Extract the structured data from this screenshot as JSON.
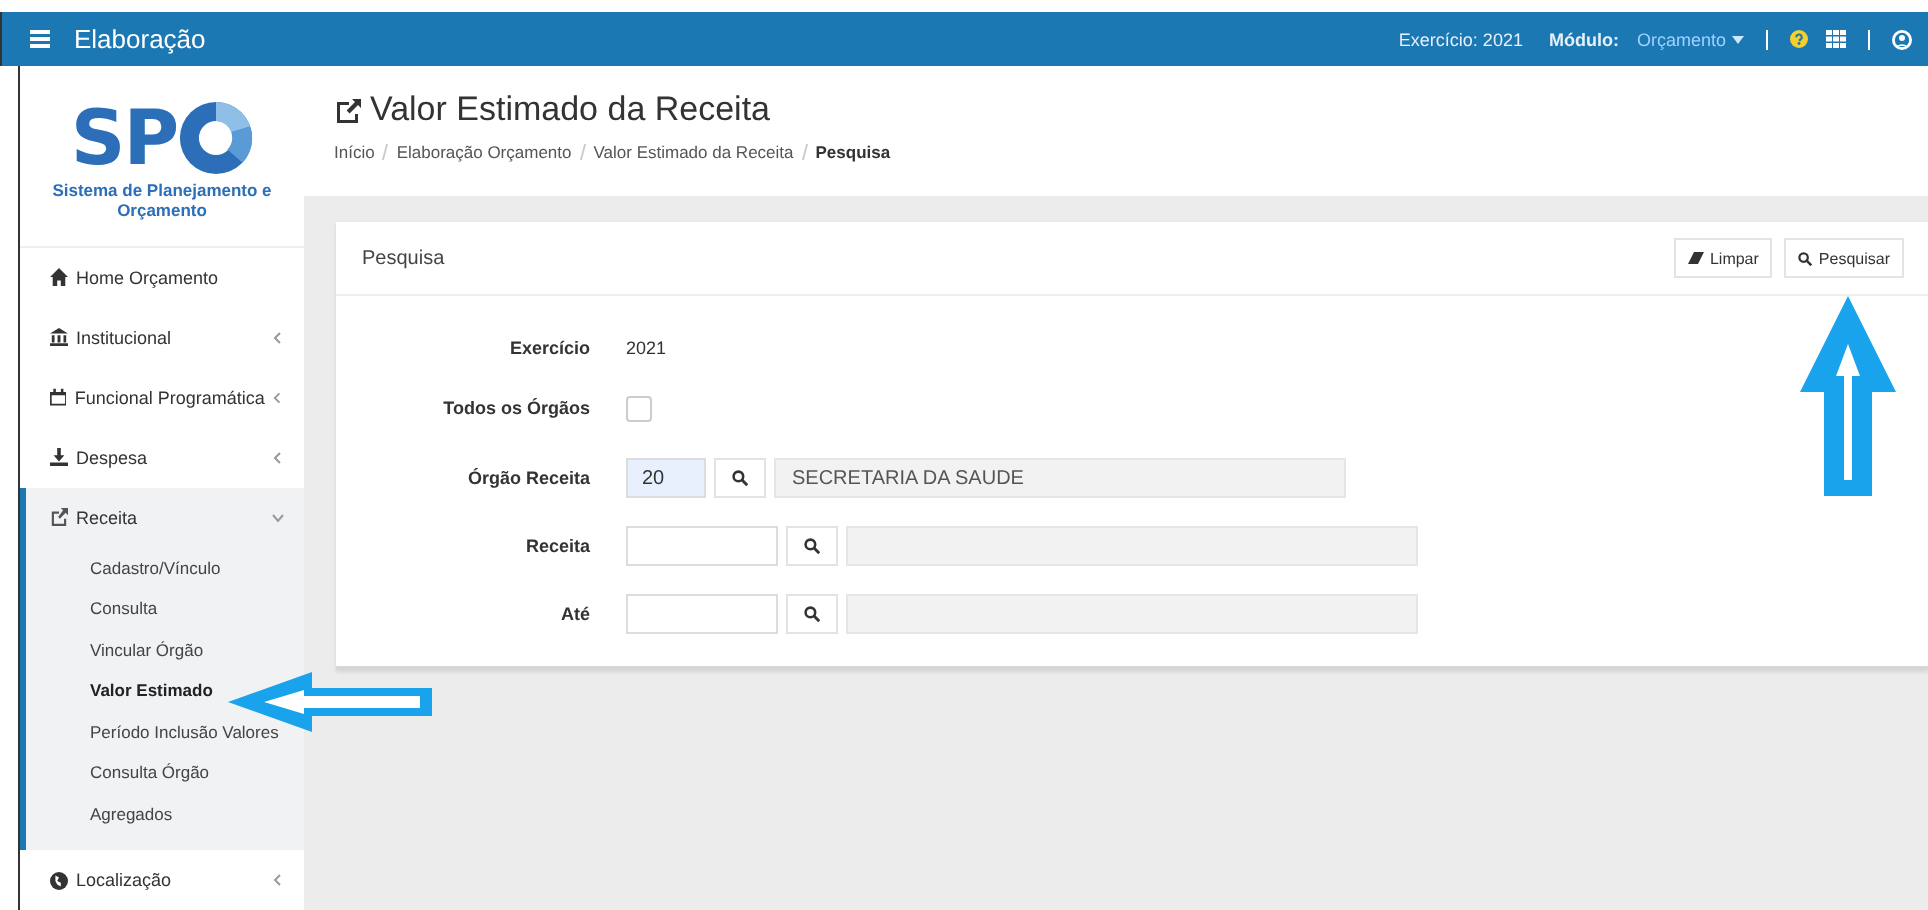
{
  "topbar": {
    "title": "Elaboração",
    "exercise_label": "Exercício:",
    "exercise_value": "2021",
    "module_label": "Módulo:",
    "module_value": "Orçamento"
  },
  "logo": {
    "text": "SP",
    "subtitle": "Sistema de Planejamento e Orçamento"
  },
  "sidebar": {
    "items": [
      {
        "label": "Home Orçamento",
        "has_children": false,
        "expanded": false
      },
      {
        "label": "Institucional",
        "has_children": true,
        "expanded": false
      },
      {
        "label": "Funcional Programática",
        "has_children": true,
        "expanded": false
      },
      {
        "label": "Despesa",
        "has_children": true,
        "expanded": false
      },
      {
        "label": "Receita",
        "has_children": true,
        "expanded": true,
        "children": [
          {
            "label": "Cadastro/Vínculo",
            "selected": false
          },
          {
            "label": "Consulta",
            "selected": false
          },
          {
            "label": "Vincular Órgão",
            "selected": false
          },
          {
            "label": "Valor Estimado",
            "selected": true
          },
          {
            "label": "Período Inclusão Valores",
            "selected": false
          },
          {
            "label": "Consulta Órgão",
            "selected": false
          },
          {
            "label": "Agregados",
            "selected": false
          }
        ]
      },
      {
        "label": "Localização",
        "has_children": true,
        "expanded": false
      }
    ]
  },
  "page": {
    "title": "Valor Estimado da Receita",
    "breadcrumb": [
      "Início",
      "Elaboração Orçamento",
      "Valor Estimado da Receita",
      "Pesquisa"
    ]
  },
  "panel": {
    "title": "Pesquisa",
    "buttons": [
      "Limpar",
      "Pesquisar"
    ],
    "fields": [
      {
        "kind": "text",
        "label": "Exercício",
        "value": "2021"
      },
      {
        "kind": "checkbox",
        "label": "Todos os Órgãos",
        "checked": false
      },
      {
        "kind": "lookup",
        "label": "Órgão Receita",
        "code": "20",
        "highlighted": true,
        "description": "SECRETARIA DA SAUDE"
      },
      {
        "kind": "lookup",
        "label": "Receita",
        "highlighted": false
      },
      {
        "kind": "lookup",
        "label": "Até",
        "highlighted": false
      }
    ]
  },
  "annotations": [
    {
      "kind": "arrow_left"
    },
    {
      "kind": "arrow_up"
    }
  ]
}
